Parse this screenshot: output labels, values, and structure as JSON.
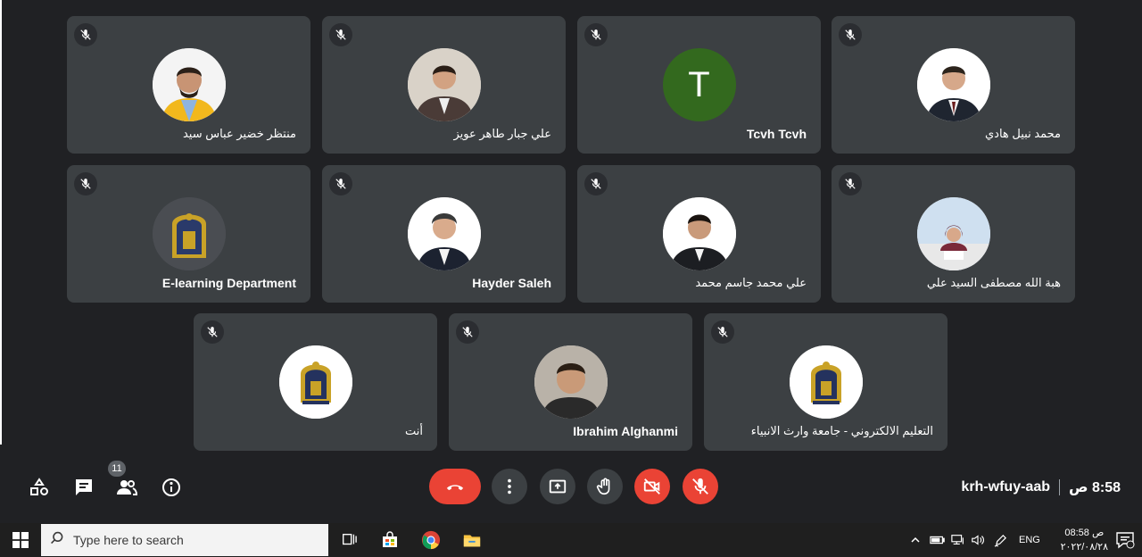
{
  "participants": [
    {
      "name": "منتظر خضير عباس سيد"
    },
    {
      "name": "علي جبار طاهر عويز"
    },
    {
      "name": "Tcvh Tcvh",
      "initial": "T"
    },
    {
      "name": "محمد نبيل هادي"
    },
    {
      "name": "E-learning Department"
    },
    {
      "name": "Hayder Saleh"
    },
    {
      "name": "علي محمد جاسم محمد"
    },
    {
      "name": "هبة الله مصطفى السيد علي"
    },
    {
      "name": "أنت"
    },
    {
      "name": "Ibrahim Alghanmi"
    },
    {
      "name": "التعليم الالكتروني - جامعة وارث الانبياء"
    }
  ],
  "toolbar": {
    "people_count": "11",
    "meeting_code": "krh-wfuy-aab",
    "time": "8:58 ص"
  },
  "taskbar": {
    "search_placeholder": "Type here to search",
    "language": "ENG",
    "clock_time": "08:58 ص",
    "clock_date": "٢٠٢٢/٠٨/٢٨"
  },
  "colors": {
    "background": "#202124",
    "tile": "#3c4043",
    "danger": "#ea4335",
    "avatar_letter": "#33691e"
  },
  "icons": {
    "mic_off": "mic-off-icon",
    "activities": "shapes-icon",
    "chat": "chat-icon",
    "people": "people-icon",
    "info": "info-icon",
    "hang_up": "phone-hangup-icon",
    "more": "more-vert-icon",
    "present": "present-screen-icon",
    "raise_hand": "hand-icon",
    "camera_off": "camera-off-icon"
  }
}
